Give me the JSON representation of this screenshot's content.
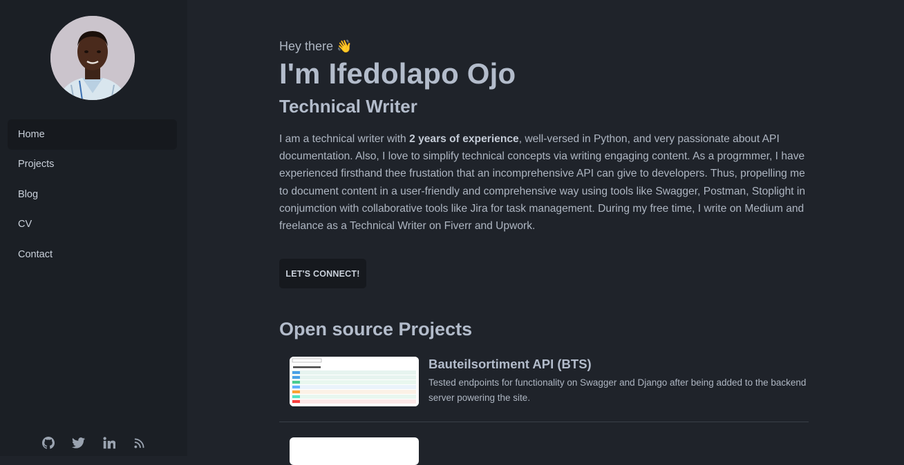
{
  "sidebar": {
    "nav": [
      {
        "label": "Home",
        "active": true
      },
      {
        "label": "Projects",
        "active": false
      },
      {
        "label": "Blog",
        "active": false
      },
      {
        "label": "CV",
        "active": false
      },
      {
        "label": "Contact",
        "active": false
      }
    ],
    "socials": [
      "github-icon",
      "twitter-icon",
      "linkedin-icon",
      "rss-icon"
    ]
  },
  "hero": {
    "greeting": "Hey there 👋",
    "name": "I'm Ifedolapo Ojo",
    "role": "Technical Writer",
    "bio_pre": "I am a technical writer with ",
    "bio_bold": "2 years of experience",
    "bio_post": ", well-versed in Python, and very passionate about API documentation. Also, I love to simplify technical concepts via writing engaging content. As a progrmmer, I have experienced firsthand thee frustation that an incomprehensive API can give to developers. Thus, propelling me to document content in a user-friendly and comprehensive way using tools like Swagger, Postman, Stoplight in conjumction with collaborative tools like Jira for task management. During my free time, I write on Medium and freelance as a Technical Writer on Fiverr and Upwork.",
    "cta_label": "LET'S CONNECT!"
  },
  "projects": {
    "title": "Open source Projects",
    "items": [
      {
        "title": "Bauteilsortiment API (BTS)",
        "description": "Tested endpoints for functionality on Swagger and Django after being added to the backend server powering the site."
      },
      {
        "title": "",
        "description": ""
      }
    ]
  },
  "colors": {
    "sidebar_bg": "#1b1f25",
    "main_bg": "#1f232a",
    "heading": "#b3bccb",
    "text": "#aeb6c2"
  }
}
